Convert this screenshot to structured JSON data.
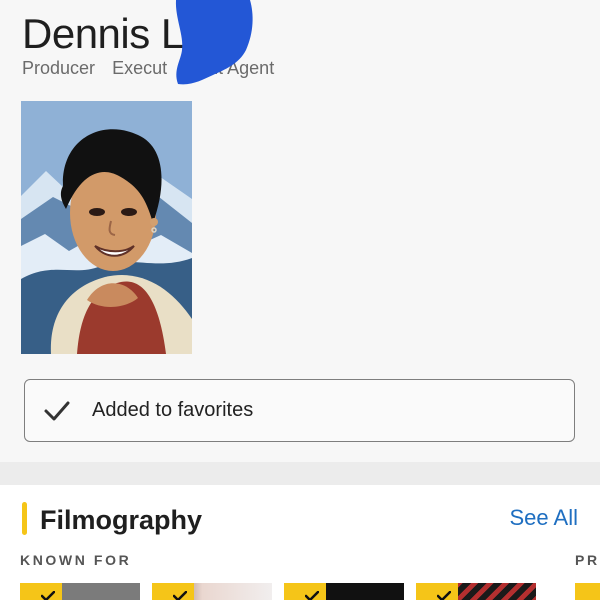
{
  "person": {
    "name": "Dennis L",
    "roles": [
      "Producer",
      "Execut",
      "alent Agent"
    ]
  },
  "favorites": {
    "label": "Added to favorites",
    "icon": "check-icon",
    "checked": true
  },
  "filmography": {
    "title": "Filmography",
    "see_all": "See All",
    "known_for": "KNOWN FOR",
    "other_heading": "PR",
    "cards": [
      {
        "icon": "check-icon",
        "poster_color": "#7b7b7b"
      },
      {
        "icon": "check-icon",
        "poster_color": "#ead7d0"
      },
      {
        "icon": "check-icon",
        "poster_color": "#111111"
      },
      {
        "icon": "check-icon",
        "poster_color": "#a92c2c"
      }
    ]
  },
  "colors": {
    "accent": "#f5c518",
    "link": "#1f6fc1",
    "background": "#f7f7f7",
    "redaction": "#2357d6"
  }
}
